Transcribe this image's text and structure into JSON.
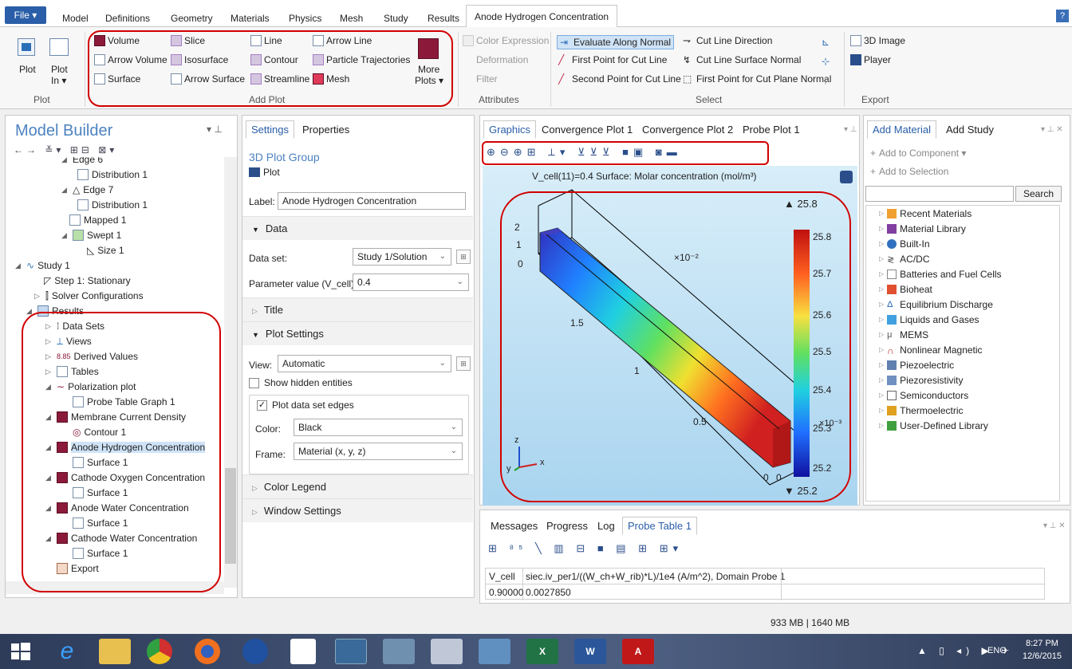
{
  "ribbon_tabs": {
    "file": "File ▾",
    "tabs": [
      "Model",
      "Definitions",
      "Geometry",
      "Materials",
      "Physics",
      "Mesh",
      "Study",
      "Results"
    ],
    "active": "Anode Hydrogen Concentration",
    "help": "?"
  },
  "ribbon": {
    "plot": {
      "label": "Plot",
      "plot_btn": "Plot",
      "plot_in_1": "Plot",
      "plot_in_2": "In ▾",
      "group": "Plot"
    },
    "add_plot": {
      "items": [
        "Volume",
        "Slice",
        "Line",
        "Arrow Line",
        "Arrow Volume",
        "Isosurface",
        "Contour",
        "Particle Trajectories",
        "Surface",
        "Arrow Surface",
        "Streamline",
        "Mesh"
      ],
      "more_1": "More",
      "more_2": "Plots ▾",
      "group": "Add Plot"
    },
    "attributes": {
      "items": [
        "Color Expression",
        "Deformation",
        "Filter"
      ],
      "group": "Attributes"
    },
    "select": {
      "items": [
        "Evaluate Along Normal",
        "Cut Line Direction",
        "First Point for Cut Line",
        "Cut Line Surface Normal",
        "Second Point for Cut Line",
        "First Point for Cut Plane Normal"
      ],
      "group": "Select"
    },
    "export": {
      "items": [
        "3D Image",
        "Player"
      ],
      "group": "Export"
    }
  },
  "model_builder": {
    "title": "Model Builder",
    "tree": [
      "Edge 6",
      "Distribution 1",
      "Edge 7",
      "Distribution 1",
      "Mapped 1",
      "Swept 1",
      "Size 1",
      "Study 1",
      "Step 1: Stationary",
      "Solver Configurations",
      "Results",
      "Data Sets",
      "Views",
      "Derived Values",
      "Tables",
      "Polarization plot",
      "Probe Table Graph 1",
      "Membrane Current Density",
      "Contour 1",
      "Anode Hydrogen Concentration",
      "Surface 1",
      "Cathode Oxygen Concentration",
      "Surface 1",
      "Anode Water Concentration",
      "Surface 1",
      "Cathode Water Concentration",
      "Surface 1",
      "Export"
    ]
  },
  "settings": {
    "tabs": [
      "Settings",
      "Properties"
    ],
    "title": "3D Plot Group",
    "plot_btn": "Plot",
    "label_label": "Label:",
    "label_value": "Anode Hydrogen Concentration",
    "data_section": "Data",
    "dataset_label": "Data set:",
    "dataset_value": "Study 1/Solution",
    "param_label": "Parameter value (V_cell):",
    "param_value": "0.4",
    "title_section": "Title",
    "plot_settings": "Plot Settings",
    "view_label": "View:",
    "view_value": "Automatic",
    "show_hidden": "Show hidden entities",
    "plot_edges": "Plot data set edges",
    "color_label": "Color:",
    "color_value": "Black",
    "frame_label": "Frame:",
    "frame_value": "Material  (x, y, z)",
    "color_legend": "Color Legend",
    "window_settings": "Window Settings"
  },
  "graphics": {
    "tabs": [
      "Graphics",
      "Convergence Plot 1",
      "Convergence Plot 2",
      "Probe Plot 1"
    ],
    "plot_title": "V_cell(11)=0.4   Surface: Molar concentration (mol/m³)",
    "max_label": "▲ 25.8",
    "min_label": "▼ 25.2",
    "colorbar_ticks": [
      "25.8",
      "25.7",
      "25.6",
      "25.5",
      "25.4",
      "25.3",
      "25.2"
    ],
    "x10_cb": "×10⁻³",
    "x10_axis": "×10⁻²",
    "axis_labels": [
      "2",
      "1",
      "0",
      "1.5",
      "1",
      "0.5",
      "0",
      "0"
    ],
    "triad": {
      "z": "z",
      "y": "y",
      "x": "x"
    }
  },
  "messages": {
    "tabs": [
      "Messages",
      "Progress",
      "Log",
      "Probe Table 1"
    ],
    "table_headers": [
      "V_cell",
      "siec.iv_per1/((W_ch+W_rib)*L)/1e4 (A/m^2), Domain Probe 1"
    ],
    "table_rows": [
      [
        "0.90000",
        "0.0027850"
      ]
    ]
  },
  "materials": {
    "tabs": [
      "Add Material",
      "Add Study"
    ],
    "add_component": "Add to Component ▾",
    "add_selection": "Add to Selection",
    "search_btn": "Search",
    "items": [
      "Recent Materials",
      "Material Library",
      "Built-In",
      "AC/DC",
      "Batteries and Fuel Cells",
      "Bioheat",
      "Equilibrium Discharge",
      "Liquids and Gases",
      "MEMS",
      "Nonlinear Magnetic",
      "Piezoelectric",
      "Piezoresistivity",
      "Semiconductors",
      "Thermoelectric",
      "User-Defined Library"
    ]
  },
  "status": {
    "memory": "933 MB | 1640 MB"
  },
  "taskbar": {
    "lang": "ENG",
    "time": "8:27 PM",
    "date": "12/6/2015"
  }
}
